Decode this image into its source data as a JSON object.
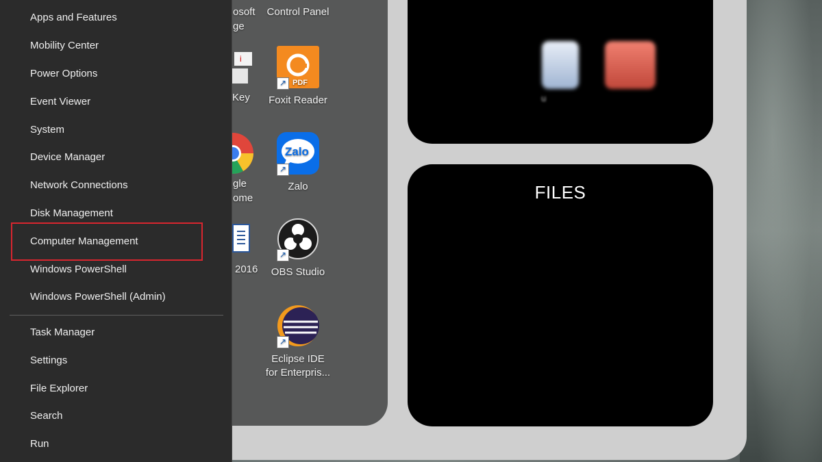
{
  "winx_menu": {
    "items": [
      {
        "label": "Apps and Features"
      },
      {
        "label": "Mobility Center"
      },
      {
        "label": "Power Options"
      },
      {
        "label": "Event Viewer"
      },
      {
        "label": "System"
      },
      {
        "label": "Device Manager"
      },
      {
        "label": "Network Connections"
      },
      {
        "label": "Disk Management"
      },
      {
        "label": "Computer Management",
        "highlighted": true
      },
      {
        "label": "Windows PowerShell"
      },
      {
        "label": "Windows PowerShell (Admin)"
      },
      {
        "label": "Task Manager"
      },
      {
        "label": "Settings"
      },
      {
        "label": "File Explorer"
      },
      {
        "label": "Search"
      },
      {
        "label": "Run"
      }
    ],
    "highlight_color": "#d9262f"
  },
  "desktop": {
    "icons": [
      {
        "label": "Control Panel",
        "icon": "control-panel-icon"
      },
      {
        "label": "Foxit Reader",
        "icon": "foxit-reader-icon",
        "badge": "PDF"
      },
      {
        "label": "Zalo",
        "icon": "zalo-icon",
        "badge": "Zalo"
      },
      {
        "label": "OBS Studio",
        "icon": "obs-studio-icon"
      },
      {
        "label": "Eclipse IDE for Enterpris...",
        "line1": "Eclipse IDE",
        "line2": "for Enterpris...",
        "icon": "eclipse-icon"
      }
    ],
    "partial_labels": {
      "edge_1": "osoft",
      "edge_2": "ge",
      "key": "Key",
      "chrome_1": "gle",
      "chrome_2": "ome",
      "word": "2016"
    }
  },
  "widgets": {
    "files_title": "FILES",
    "blurred_text": "u"
  }
}
